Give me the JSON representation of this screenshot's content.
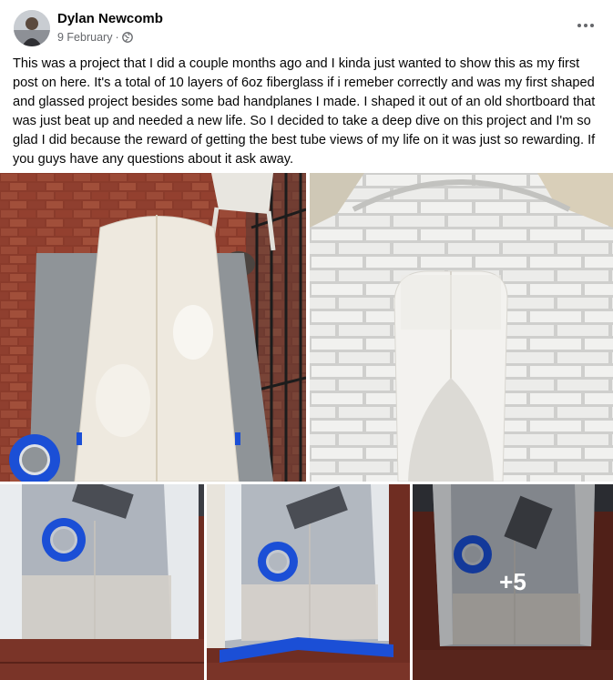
{
  "post": {
    "author": "Dylan Newcomb",
    "date": "9 February",
    "separator": "·",
    "privacy_icon": "globe-icon",
    "menu_icon": "more-options-icon",
    "text": "This was a project that I did a couple months ago and I kinda just wanted to show this as my first post on here. It's a total of 10 layers of 6oz fiberglass if i remeber correctly and was my first shaped and glassed project besides some bad handplanes I made. I shaped it out of an old shortboard that was just beat up and needed a new life. So I decided to take a deep dive on this project and I'm so glad I did because the reward of getting the best tube views of my life on it was just so rewarding. If you guys have any questions about it ask away."
  },
  "gallery": {
    "more_count": "+5"
  },
  "colors": {
    "text_primary": "#050505",
    "text_secondary": "#65676b",
    "brick": "#8e3a2a",
    "foam_white": "#eeeae2",
    "tape_blue": "#1b4fd6"
  }
}
